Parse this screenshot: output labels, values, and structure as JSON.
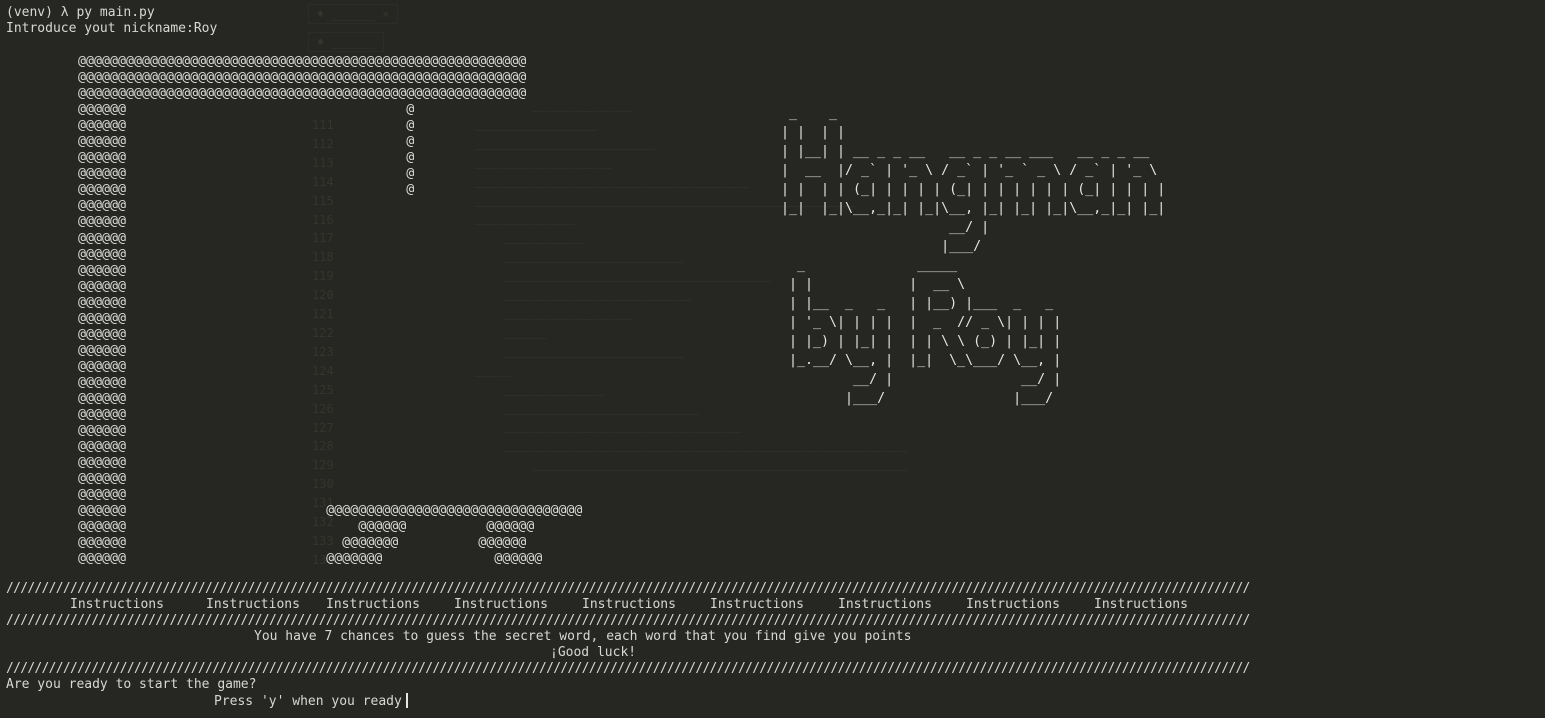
{
  "terminal": {
    "command_line": "(venv) λ py main.py",
    "nickname_prompt": "Introduce yout nickname:Roy"
  },
  "hangman_art": "@@@@@@@@@@@@@@@@@@@@@@@@@@@@@@@@@@@@@@@@@@@@@@@@@@@@@@@@\n@@@@@@@@@@@@@@@@@@@@@@@@@@@@@@@@@@@@@@@@@@@@@@@@@@@@@@@@\n@@@@@@@@@@@@@@@@@@@@@@@@@@@@@@@@@@@@@@@@@@@@@@@@@@@@@@@@\n@@@@@@                                   @\n@@@@@@                                   @\n@@@@@@                                   @\n@@@@@@                                   @\n@@@@@@                                   @\n@@@@@@                                   @\n@@@@@@\n@@@@@@\n@@@@@@\n@@@@@@\n@@@@@@\n@@@@@@\n@@@@@@\n@@@@@@\n@@@@@@\n@@@@@@\n@@@@@@\n@@@@@@\n@@@@@@\n@@@@@@\n@@@@@@\n@@@@@@\n@@@@@@\n@@@@@@\n@@@@@@\n@@@@@@                         @@@@@@@@@@@@@@@@@@@@@@@@@@@@@@@@\n@@@@@@                             @@@@@@          @@@@@@\n@@@@@@                           @@@@@@@          @@@@@@\n@@@@@@                         @@@@@@@              @@@@@@",
  "logo_art": "  _    _\n | |  | |\n | |__| | __ _ _ __   __ _ _ __ ___   __ _ _ __\n |  __  |/ _` | '_ \\ / _` | '_ ` _ \\ / _` | '_ \\\n | |  | | (_| | | | | (_| | | | | | | (_| | | | |\n |_|  |_|\\__,_|_| |_|\\__, |_| |_| |_|\\__,_|_| |_|\n                      __/ |\n                     |___/\n   _              _____\n  | |            |  __ \\\n  | |__  _   _   | |__) |___  _   _\n  | '_ \\| | | |  |  _  // _ \\| | | |\n  | |_) | |_| |  | | \\ \\ (_) | |_| |\n  |_.__/ \\__, |  |_|  \\_\\___/ \\__, |\n          __/ |                __/ |\n         |___/                |___/",
  "divider": "///////////////////////////////////////////////////////////////////////////////////////////////////////////////////////////////////////////////////////////////////////////////",
  "instructions_label": "Instructions",
  "instruction_text": "You have 7 chances to guess the secret word, each word that you find give you points",
  "good_luck": "¡Good luck!",
  "ready_question": "Are you ready to start the game?",
  "ready_prompt": "Press 'y' when you ready"
}
